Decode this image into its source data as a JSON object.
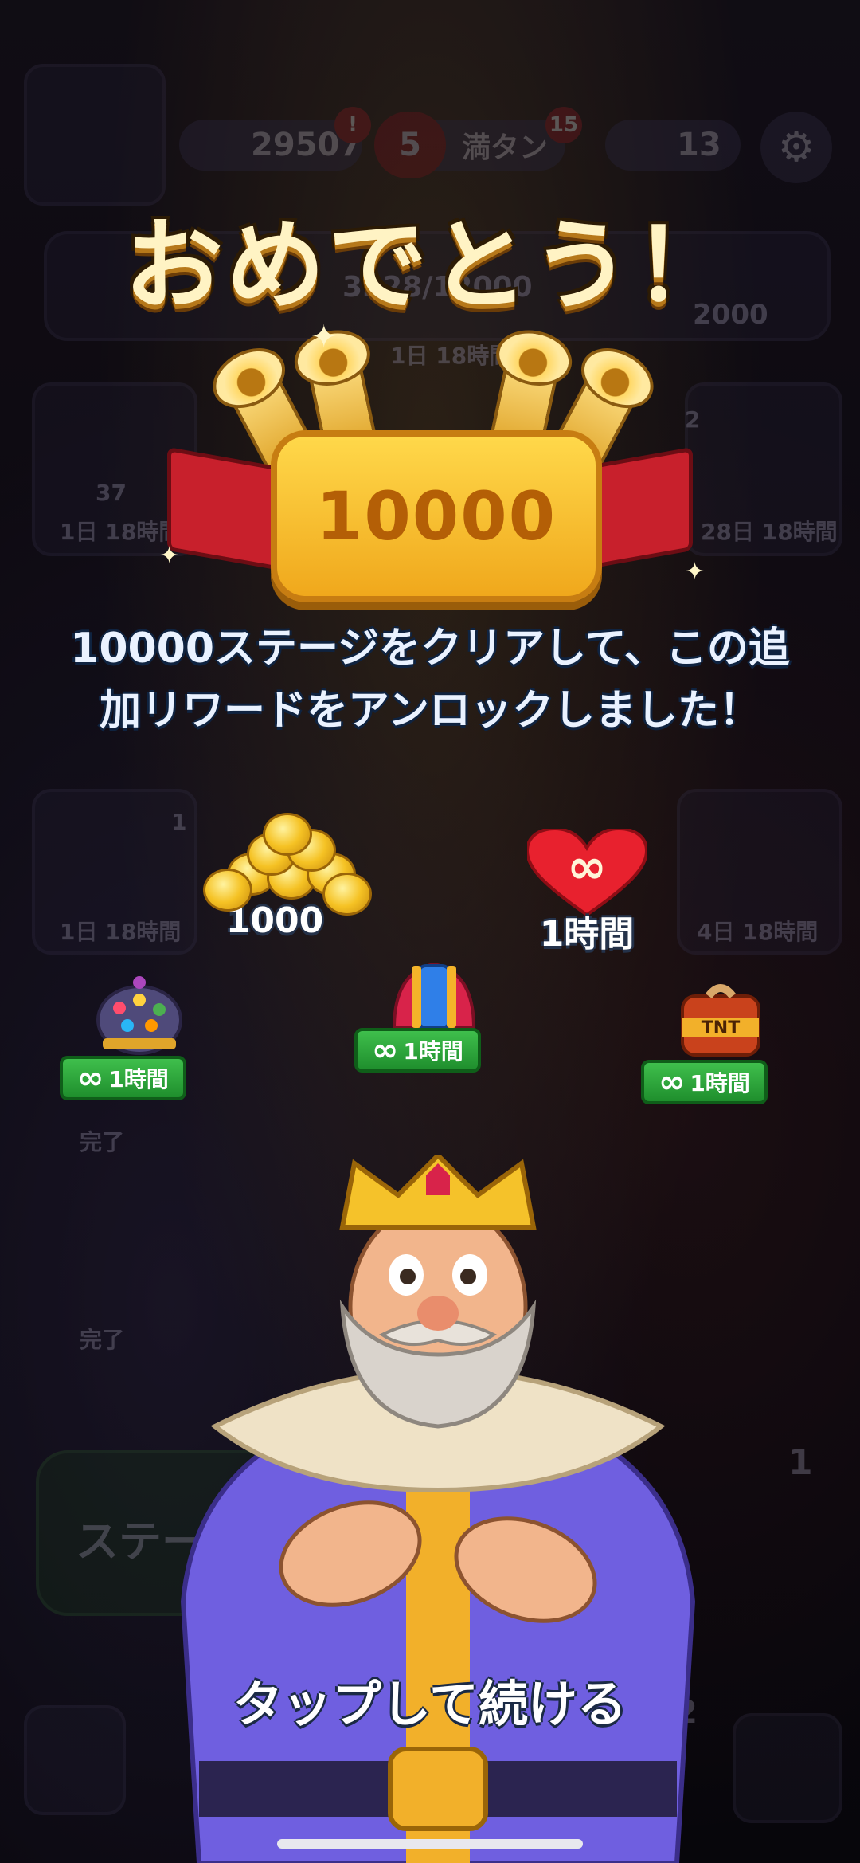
{
  "hud": {
    "coins": "29507",
    "coins_alert": "!",
    "lives": "5",
    "lives_status": "満タン",
    "lives_timer_badge": "15",
    "stars": "13"
  },
  "background": {
    "progress_text": "3228/12000",
    "event_timer": "1日 18時間",
    "reward_amount": "2000",
    "left_tile_count": "37",
    "left_tile_timer": "1日 18時間",
    "right_tile_badge": "2",
    "right_tile_timer": "28日 18時間",
    "left_tile2_timer": "1日 18時間",
    "left_tile2_badge": "1",
    "right_tile2_timer": "4日 18時間",
    "done_1": "完了",
    "done_2": "完了",
    "stage_button": "ステー",
    "bottom_badge_1": "1",
    "bottom_badge_2": "2"
  },
  "title": "おめでとう！",
  "milestone_value": "10000",
  "message_line1": "10000ステージをクリアして、この追",
  "message_line2": "加リワードをアンロックしました！",
  "rewards": {
    "coins_amount": "1000",
    "infinite_lives_duration": "1時間",
    "booster1_duration": "1時間",
    "booster2_duration": "1時間",
    "booster3_duration": "1時間",
    "infinity_symbol": "∞",
    "tnt_label": "TNT"
  },
  "continue_label": "タップして続ける"
}
